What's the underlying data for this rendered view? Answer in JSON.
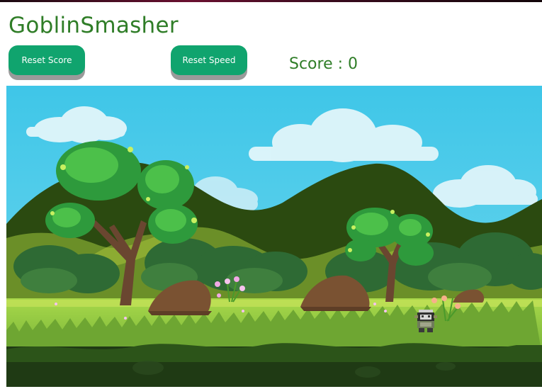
{
  "app": {
    "title": "GoblinSmasher"
  },
  "controls": {
    "reset_score_label": "Reset Score",
    "reset_speed_label": "Reset Speed"
  },
  "score": {
    "label": "Score : 0",
    "value": 0
  },
  "game": {
    "icons": [
      "goblin-icon",
      "tree-icon",
      "rock-icon",
      "flower-icon",
      "cloud-icon"
    ]
  },
  "colors": {
    "title": "#2f7d27",
    "button": "#10a46e",
    "sky": "#3ec8e6",
    "grass": "#8cc63e"
  }
}
